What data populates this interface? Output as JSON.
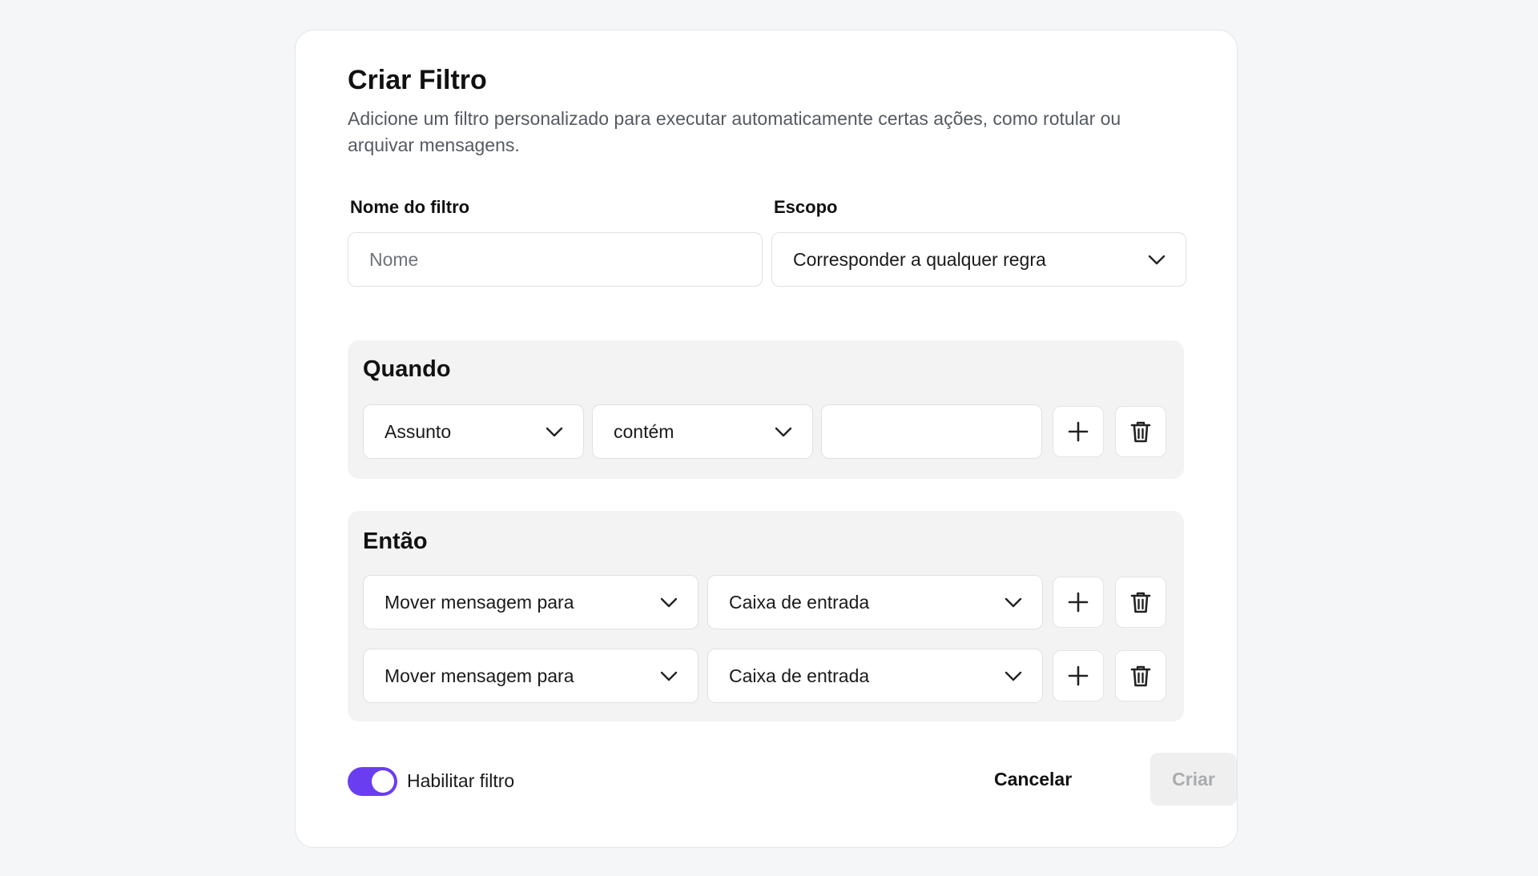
{
  "dialog": {
    "title": "Criar Filtro",
    "subtitle": "Adicione um filtro personalizado para executar automaticamente certas ações, como rotular ou arquivar mensagens."
  },
  "form": {
    "name_label": "Nome do filtro",
    "name_placeholder": "Nome",
    "name_value": "",
    "scope_label": "Escopo",
    "scope_value": "Corresponder a qualquer regra"
  },
  "when": {
    "title": "Quando",
    "conditions": [
      {
        "field": "Assunto",
        "operator": "contém",
        "value": ""
      }
    ]
  },
  "then": {
    "title": "Então",
    "actions": [
      {
        "action": "Mover mensagem para",
        "target": "Caixa de entrada"
      },
      {
        "action": "Mover mensagem para",
        "target": "Caixa de entrada"
      }
    ]
  },
  "footer": {
    "toggle_label": "Habilitar filtro",
    "toggle_on": true,
    "cancel_label": "Cancelar",
    "create_label": "Criar",
    "create_disabled": true
  },
  "colors": {
    "accent": "#6a3df0",
    "background": "#f5f6f8",
    "section_bg": "#f3f3f3",
    "disabled_text": "#a9abae"
  },
  "icons": {
    "dropdown": "chevron-down-icon",
    "add": "plus-icon",
    "delete": "trash-icon"
  }
}
